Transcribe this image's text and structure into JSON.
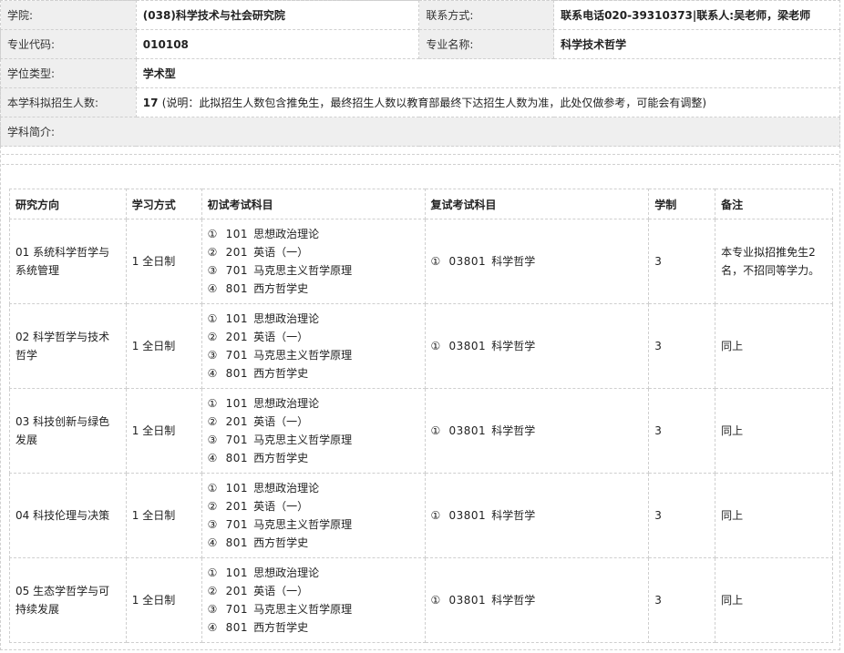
{
  "info": {
    "college_label": "学院:",
    "college_value": "(038)科学技术与社会研究院",
    "contact_label": "联系方式:",
    "contact_value": "联系电话020-39310373|联系人:吴老师，梁老师",
    "major_code_label": "专业代码:",
    "major_code_value": "010108",
    "major_name_label": "专业名称:",
    "major_name_value": "科学技术哲学",
    "degree_type_label": "学位类型:",
    "degree_type_value": "学术型",
    "enrollment_label": "本学科拟招生人数:",
    "enrollment_value": "17",
    "enrollment_note": "(说明：此拟招生人数包含推免生，最终招生人数以教育部最终下达招生人数为准，此处仅做参考，可能会有调整)",
    "intro_label": "学科简介:"
  },
  "table": {
    "headers": [
      "研究方向",
      "学习方式",
      "初试考试科目",
      "复试考试科目",
      "学制",
      "备注"
    ],
    "rows": [
      {
        "direction": "01 系统科学哲学与系统管理",
        "mode": "1 全日制",
        "exams": [
          {
            "num": "①",
            "code": "101",
            "name": "思想政治理论"
          },
          {
            "num": "②",
            "code": "201",
            "name": "英语（一）"
          },
          {
            "num": "③",
            "code": "701",
            "name": "马克思主义哲学原理"
          },
          {
            "num": "④",
            "code": "801",
            "name": "西方哲学史"
          }
        ],
        "retest": {
          "num": "①",
          "code": "03801",
          "name": "科学哲学"
        },
        "years": "3",
        "remark": "本专业拟招推免生2名，不招同等学力。"
      },
      {
        "direction": "02 科学哲学与技术哲学",
        "mode": "1 全日制",
        "exams": [
          {
            "num": "①",
            "code": "101",
            "name": "思想政治理论"
          },
          {
            "num": "②",
            "code": "201",
            "name": "英语（一）"
          },
          {
            "num": "③",
            "code": "701",
            "name": "马克思主义哲学原理"
          },
          {
            "num": "④",
            "code": "801",
            "name": "西方哲学史"
          }
        ],
        "retest": {
          "num": "①",
          "code": "03801",
          "name": "科学哲学"
        },
        "years": "3",
        "remark": "同上"
      },
      {
        "direction": "03 科技创新与绿色发展",
        "mode": "1 全日制",
        "exams": [
          {
            "num": "①",
            "code": "101",
            "name": "思想政治理论"
          },
          {
            "num": "②",
            "code": "201",
            "name": "英语（一）"
          },
          {
            "num": "③",
            "code": "701",
            "name": "马克思主义哲学原理"
          },
          {
            "num": "④",
            "code": "801",
            "name": "西方哲学史"
          }
        ],
        "retest": {
          "num": "①",
          "code": "03801",
          "name": "科学哲学"
        },
        "years": "3",
        "remark": "同上"
      },
      {
        "direction": "04 科技伦理与决策",
        "mode": "1 全日制",
        "exams": [
          {
            "num": "①",
            "code": "101",
            "name": "思想政治理论"
          },
          {
            "num": "②",
            "code": "201",
            "name": "英语（一）"
          },
          {
            "num": "③",
            "code": "701",
            "name": "马克思主义哲学原理"
          },
          {
            "num": "④",
            "code": "801",
            "name": "西方哲学史"
          }
        ],
        "retest": {
          "num": "①",
          "code": "03801",
          "name": "科学哲学"
        },
        "years": "3",
        "remark": "同上"
      },
      {
        "direction": "05 生态学哲学与可持续发展",
        "mode": "1 全日制",
        "exams": [
          {
            "num": "①",
            "code": "101",
            "name": "思想政治理论"
          },
          {
            "num": "②",
            "code": "201",
            "name": "英语（一）"
          },
          {
            "num": "③",
            "code": "701",
            "name": "马克思主义哲学原理"
          },
          {
            "num": "④",
            "code": "801",
            "name": "西方哲学史"
          }
        ],
        "retest": {
          "num": "①",
          "code": "03801",
          "name": "科学哲学"
        },
        "years": "3",
        "remark": "同上"
      }
    ]
  }
}
